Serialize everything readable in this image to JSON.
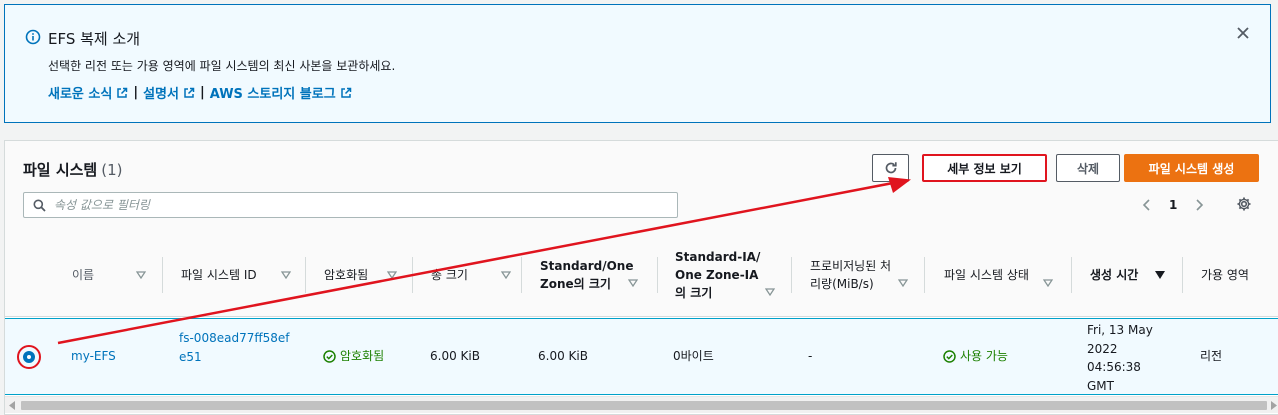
{
  "banner": {
    "title": "EFS 복제 소개",
    "description": "선택한 리전 또는 가용 영역에 파일 시스템의 최신 사본을 보관하세요.",
    "links": [
      "새로운 소식",
      "설명서",
      "AWS 스토리지 블로그"
    ],
    "separator": "|"
  },
  "panel": {
    "title": "파일 시스템",
    "count": "(1)",
    "buttons": {
      "details": "세부 정보 보기",
      "delete": "삭제",
      "create": "파일 시스템 생성"
    },
    "filter_placeholder": "속성 값으로 필터링",
    "page": "1"
  },
  "columns": [
    "이름",
    "파일 시스템 ID",
    "암호화됨",
    "총 크기",
    "Standard/One Zone의 크기",
    "Standard-IA/One Zone-IA의 크기",
    "프로비저닝된 처리량(MiB/s)",
    "파일 시스템 상태",
    "생성 시간",
    "가용 영역"
  ],
  "rows": [
    {
      "name": "my-EFS",
      "id": "fs-008ead77ff58efe51",
      "encrypted": "암호화됨",
      "total_size": "6.00 KiB",
      "standard_size": "6.00 KiB",
      "ia_size": "0바이트",
      "throughput": "-",
      "state": "사용 가능",
      "created": "Fri, 13 May 2022 04:56:38 GMT",
      "az": "리전"
    }
  ],
  "colors": {
    "accent": "#0073bb",
    "primary_button": "#ec7211",
    "success": "#1d8102",
    "annotation": "#e0141e"
  }
}
